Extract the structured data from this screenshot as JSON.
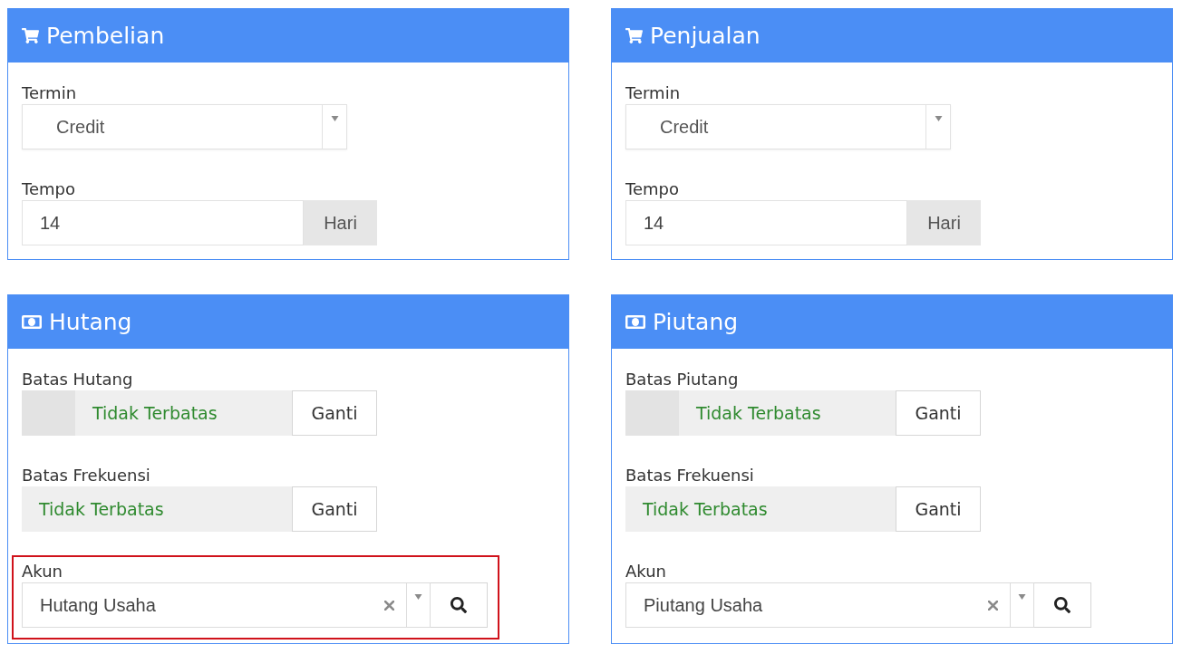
{
  "panels": [
    {
      "kind": "terms",
      "title": "Pembelian",
      "fields": [
        {
          "kind": "select",
          "label": "Termin",
          "value": "Credit"
        },
        {
          "kind": "unit_input",
          "label": "Tempo",
          "value": "14",
          "unit": "Hari"
        }
      ]
    },
    {
      "kind": "terms",
      "title": "Penjualan",
      "fields": [
        {
          "kind": "select",
          "label": "Termin",
          "value": "Credit"
        },
        {
          "kind": "unit_input",
          "label": "Tempo",
          "value": "14",
          "unit": "Hari"
        }
      ]
    },
    {
      "kind": "limits",
      "title": "Hutang",
      "fields": [
        {
          "kind": "limit",
          "label": "Batas Hutang",
          "value": "Tidak Terbatas",
          "button": "Ganti",
          "blank_addon": true
        },
        {
          "kind": "limit",
          "label": "Batas Frekuensi",
          "value": "Tidak Terbatas",
          "button": "Ganti",
          "blank_addon": false
        },
        {
          "kind": "account",
          "label": "Akun",
          "value": "Hutang Usaha",
          "highlighted": true
        }
      ]
    },
    {
      "kind": "limits",
      "title": "Piutang",
      "fields": [
        {
          "kind": "limit",
          "label": "Batas Piutang",
          "value": "Tidak Terbatas",
          "button": "Ganti",
          "blank_addon": true
        },
        {
          "kind": "limit",
          "label": "Batas Frekuensi",
          "value": "Tidak Terbatas",
          "button": "Ganti",
          "blank_addon": false
        },
        {
          "kind": "account",
          "label": "Akun",
          "value": "Piutang Usaha",
          "highlighted": false
        }
      ]
    }
  ]
}
